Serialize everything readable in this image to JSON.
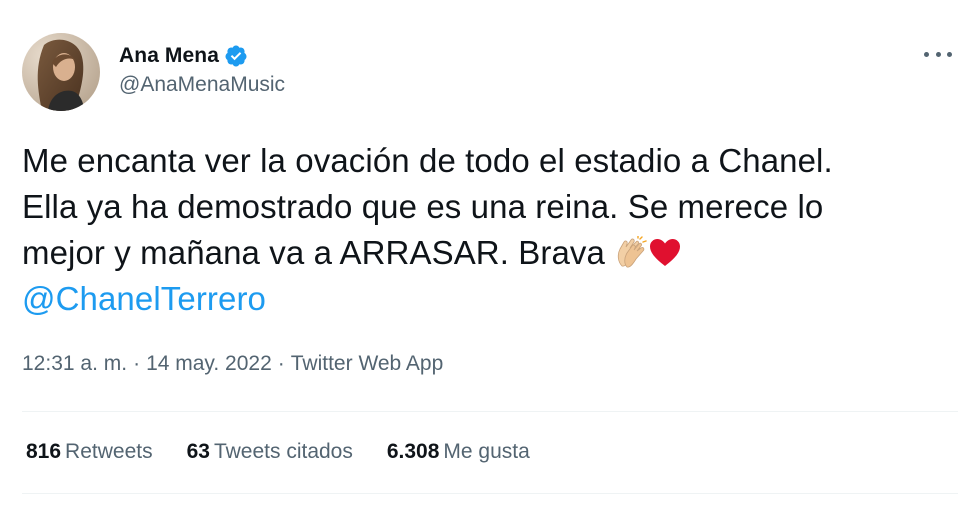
{
  "author": {
    "display_name": "Ana Mena",
    "handle": "@AnaMenaMusic",
    "verified": true
  },
  "tweet": {
    "line1": "Me encanta ver la ovación de todo el estadio a Chanel.",
    "line2": "Ella ya ha demostrado que es una reina. Se merece lo",
    "line3_text": "mejor y mañana va a ARRASAR. Brava",
    "emojis": [
      "clapping-hands",
      "red-heart"
    ],
    "mention": "@ChanelTerrero"
  },
  "meta": {
    "time": "12:31 a. m.",
    "separator": "·",
    "date": "14 may. 2022",
    "source": "Twitter Web App"
  },
  "stats": {
    "retweets_count": "816",
    "retweets_label": "Retweets",
    "quotes_count": "63",
    "quotes_label": "Tweets citados",
    "likes_count": "6.308",
    "likes_label": "Me gusta"
  },
  "colors": {
    "link": "#1d9bf0",
    "secondary_text": "#536471",
    "primary_text": "#0f1419",
    "verified": "#1d9bf0"
  }
}
